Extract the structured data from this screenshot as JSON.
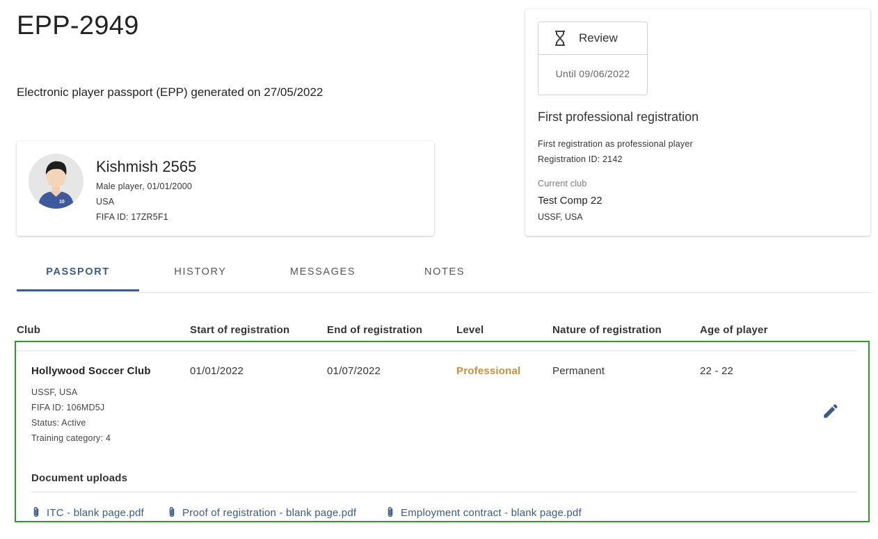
{
  "header": {
    "title": "EPP-2949",
    "subtitle": "Electronic player passport (EPP) generated on 27/05/2022"
  },
  "player": {
    "name": "Kishmish 2565",
    "details": "Male player, 01/01/2000",
    "country": "USA",
    "fifa_id": "FIFA ID: 17ZR5F1",
    "jersey_number": "10"
  },
  "status": {
    "icon": "hourglass-icon",
    "label": "Review",
    "until": "Until 09/06/2022",
    "registration_title": "First professional registration",
    "registration_desc": "First registration as professional player",
    "registration_id": "Registration ID: 2142",
    "current_club_caption": "Current club",
    "current_club_name": "Test Comp 22",
    "current_club_country": "USSF, USA"
  },
  "tabs": [
    {
      "label": "PASSPORT",
      "active": true
    },
    {
      "label": "HISTORY",
      "active": false
    },
    {
      "label": "MESSAGES",
      "active": false
    },
    {
      "label": "NOTES",
      "active": false
    }
  ],
  "table": {
    "columns": [
      "Club",
      "Start of registration",
      "End of registration",
      "Level",
      "Nature of registration",
      "Age of player"
    ],
    "row": {
      "club": "Hollywood Soccer Club",
      "start": "01/01/2022",
      "end": "01/07/2022",
      "level": "Professional",
      "nature": "Permanent",
      "age": "22 - 22",
      "club_country": "USSF, USA",
      "club_fifa_id": "FIFA ID: 106MD5J",
      "club_status": "Status: Active",
      "training_category": "Training category: 4",
      "edit_icon": "pencil-icon",
      "documents_heading": "Document uploads",
      "documents": [
        "ITC - blank page.pdf",
        "Proof of registration - blank page.pdf",
        "Employment contract - blank page.pdf"
      ]
    }
  },
  "colors": {
    "accent": "#3b5a86",
    "professional": "#c79040",
    "highlight_border": "#2e9a2e"
  }
}
